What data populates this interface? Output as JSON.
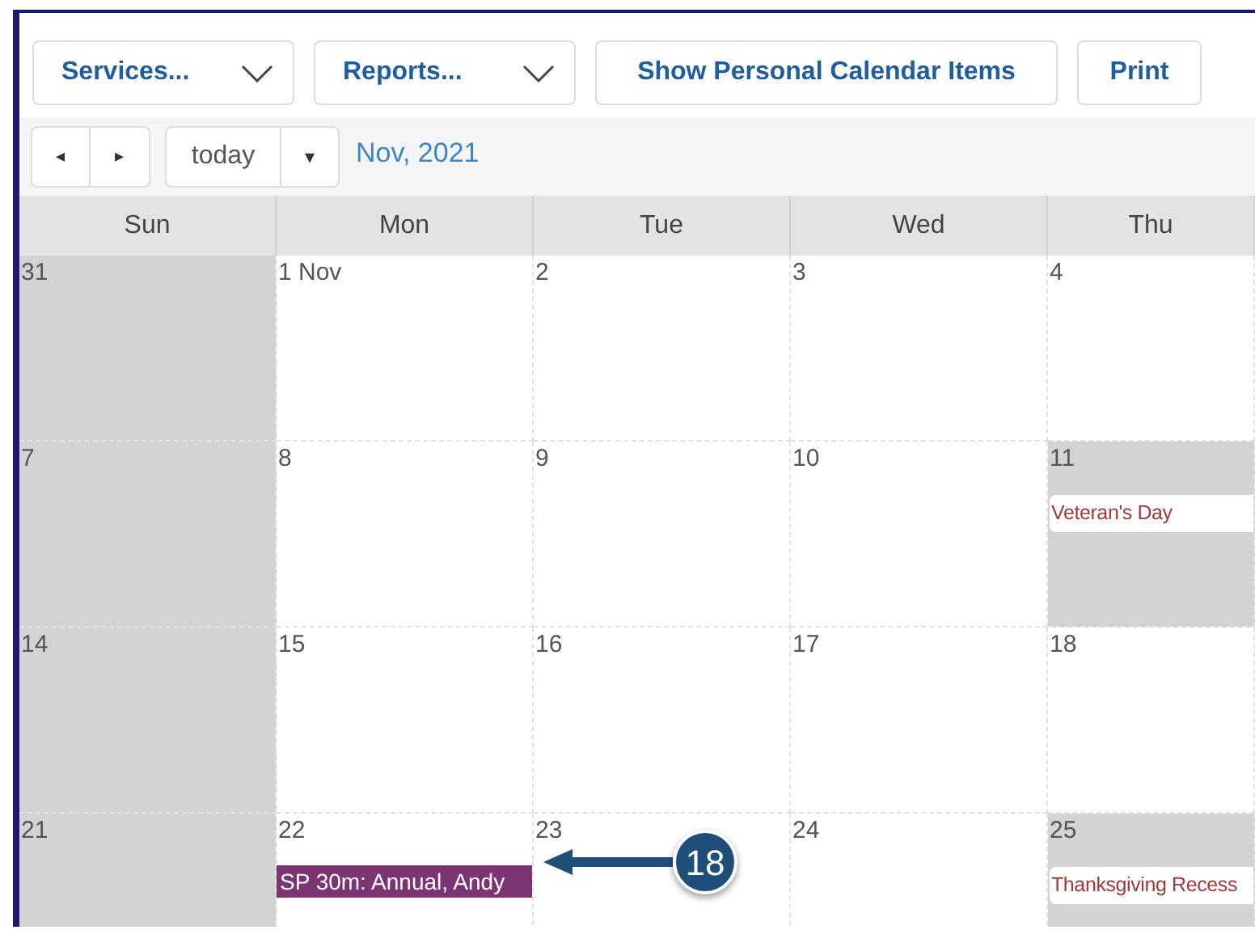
{
  "toolbar": [
    {
      "kind": "dropdown",
      "label": "Services..."
    },
    {
      "kind": "dropdown",
      "label": "Reports..."
    },
    {
      "kind": "button",
      "label": "Show Personal Calendar Items"
    },
    {
      "kind": "button",
      "label": "Print"
    }
  ],
  "nav": {
    "prev": "◂",
    "next": "▸",
    "today": "today",
    "menu": "▾",
    "title": "Nov, 2021"
  },
  "weekdays": [
    "Sun",
    "Mon",
    "Tue",
    "Wed",
    "Thu"
  ],
  "weeks": [
    [
      {
        "day": "31",
        "shaded": true
      },
      {
        "day": "1 Nov",
        "shaded": false
      },
      {
        "day": "2",
        "shaded": false
      },
      {
        "day": "3",
        "shaded": false
      },
      {
        "day": "4",
        "shaded": false
      }
    ],
    [
      {
        "day": "7",
        "shaded": true
      },
      {
        "day": "8",
        "shaded": false
      },
      {
        "day": "9",
        "shaded": false
      },
      {
        "day": "10",
        "shaded": false
      },
      {
        "day": "11",
        "shaded": true,
        "events": [
          {
            "kind": "holiday",
            "label": "Veteran's Day"
          }
        ]
      }
    ],
    [
      {
        "day": "14",
        "shaded": true
      },
      {
        "day": "15",
        "shaded": false
      },
      {
        "day": "16",
        "shaded": false
      },
      {
        "day": "17",
        "shaded": false
      },
      {
        "day": "18",
        "shaded": false
      }
    ],
    [
      {
        "day": "21",
        "shaded": true
      },
      {
        "day": "22",
        "shaded": false,
        "events": [
          {
            "kind": "appointment",
            "label": "SP 30m: Annual, Andy"
          }
        ]
      },
      {
        "day": "23",
        "shaded": false
      },
      {
        "day": "24",
        "shaded": false
      },
      {
        "day": "25",
        "shaded": true,
        "events": [
          {
            "kind": "holiday",
            "label": "Thanksgiving Recess"
          }
        ]
      }
    ]
  ],
  "callout": {
    "label": "18"
  }
}
